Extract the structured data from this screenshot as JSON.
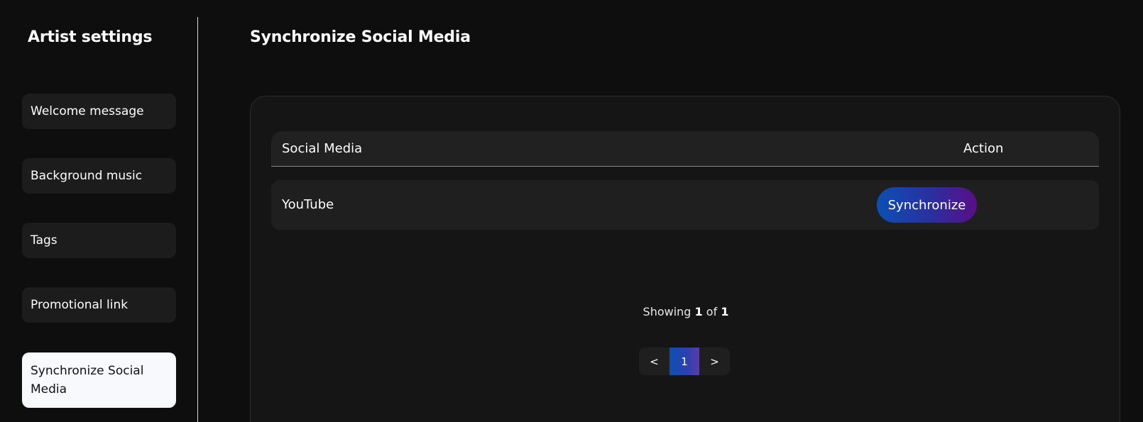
{
  "sidebar": {
    "title": "Artist settings",
    "items": [
      {
        "label": "Welcome message"
      },
      {
        "label": "Background music"
      },
      {
        "label": "Tags"
      },
      {
        "label": "Promotional link"
      },
      {
        "label": "Synchronize Social Media",
        "active": true
      }
    ]
  },
  "main": {
    "title": "Synchronize Social Media",
    "table": {
      "columns": [
        "Social Media",
        "Action"
      ],
      "rows": [
        {
          "name": "YouTube",
          "action_label": "Synchronize"
        }
      ]
    },
    "showing": {
      "prefix": "Showing",
      "current": "1",
      "sep": "of",
      "total": "1"
    },
    "pagination": {
      "prev": "<",
      "pages": [
        "1"
      ],
      "next": ">"
    }
  },
  "colors": {
    "background": "#0e0e0e",
    "card": "#151515",
    "accent_start": "#0c4fb4",
    "accent_end": "#5a0e87"
  }
}
